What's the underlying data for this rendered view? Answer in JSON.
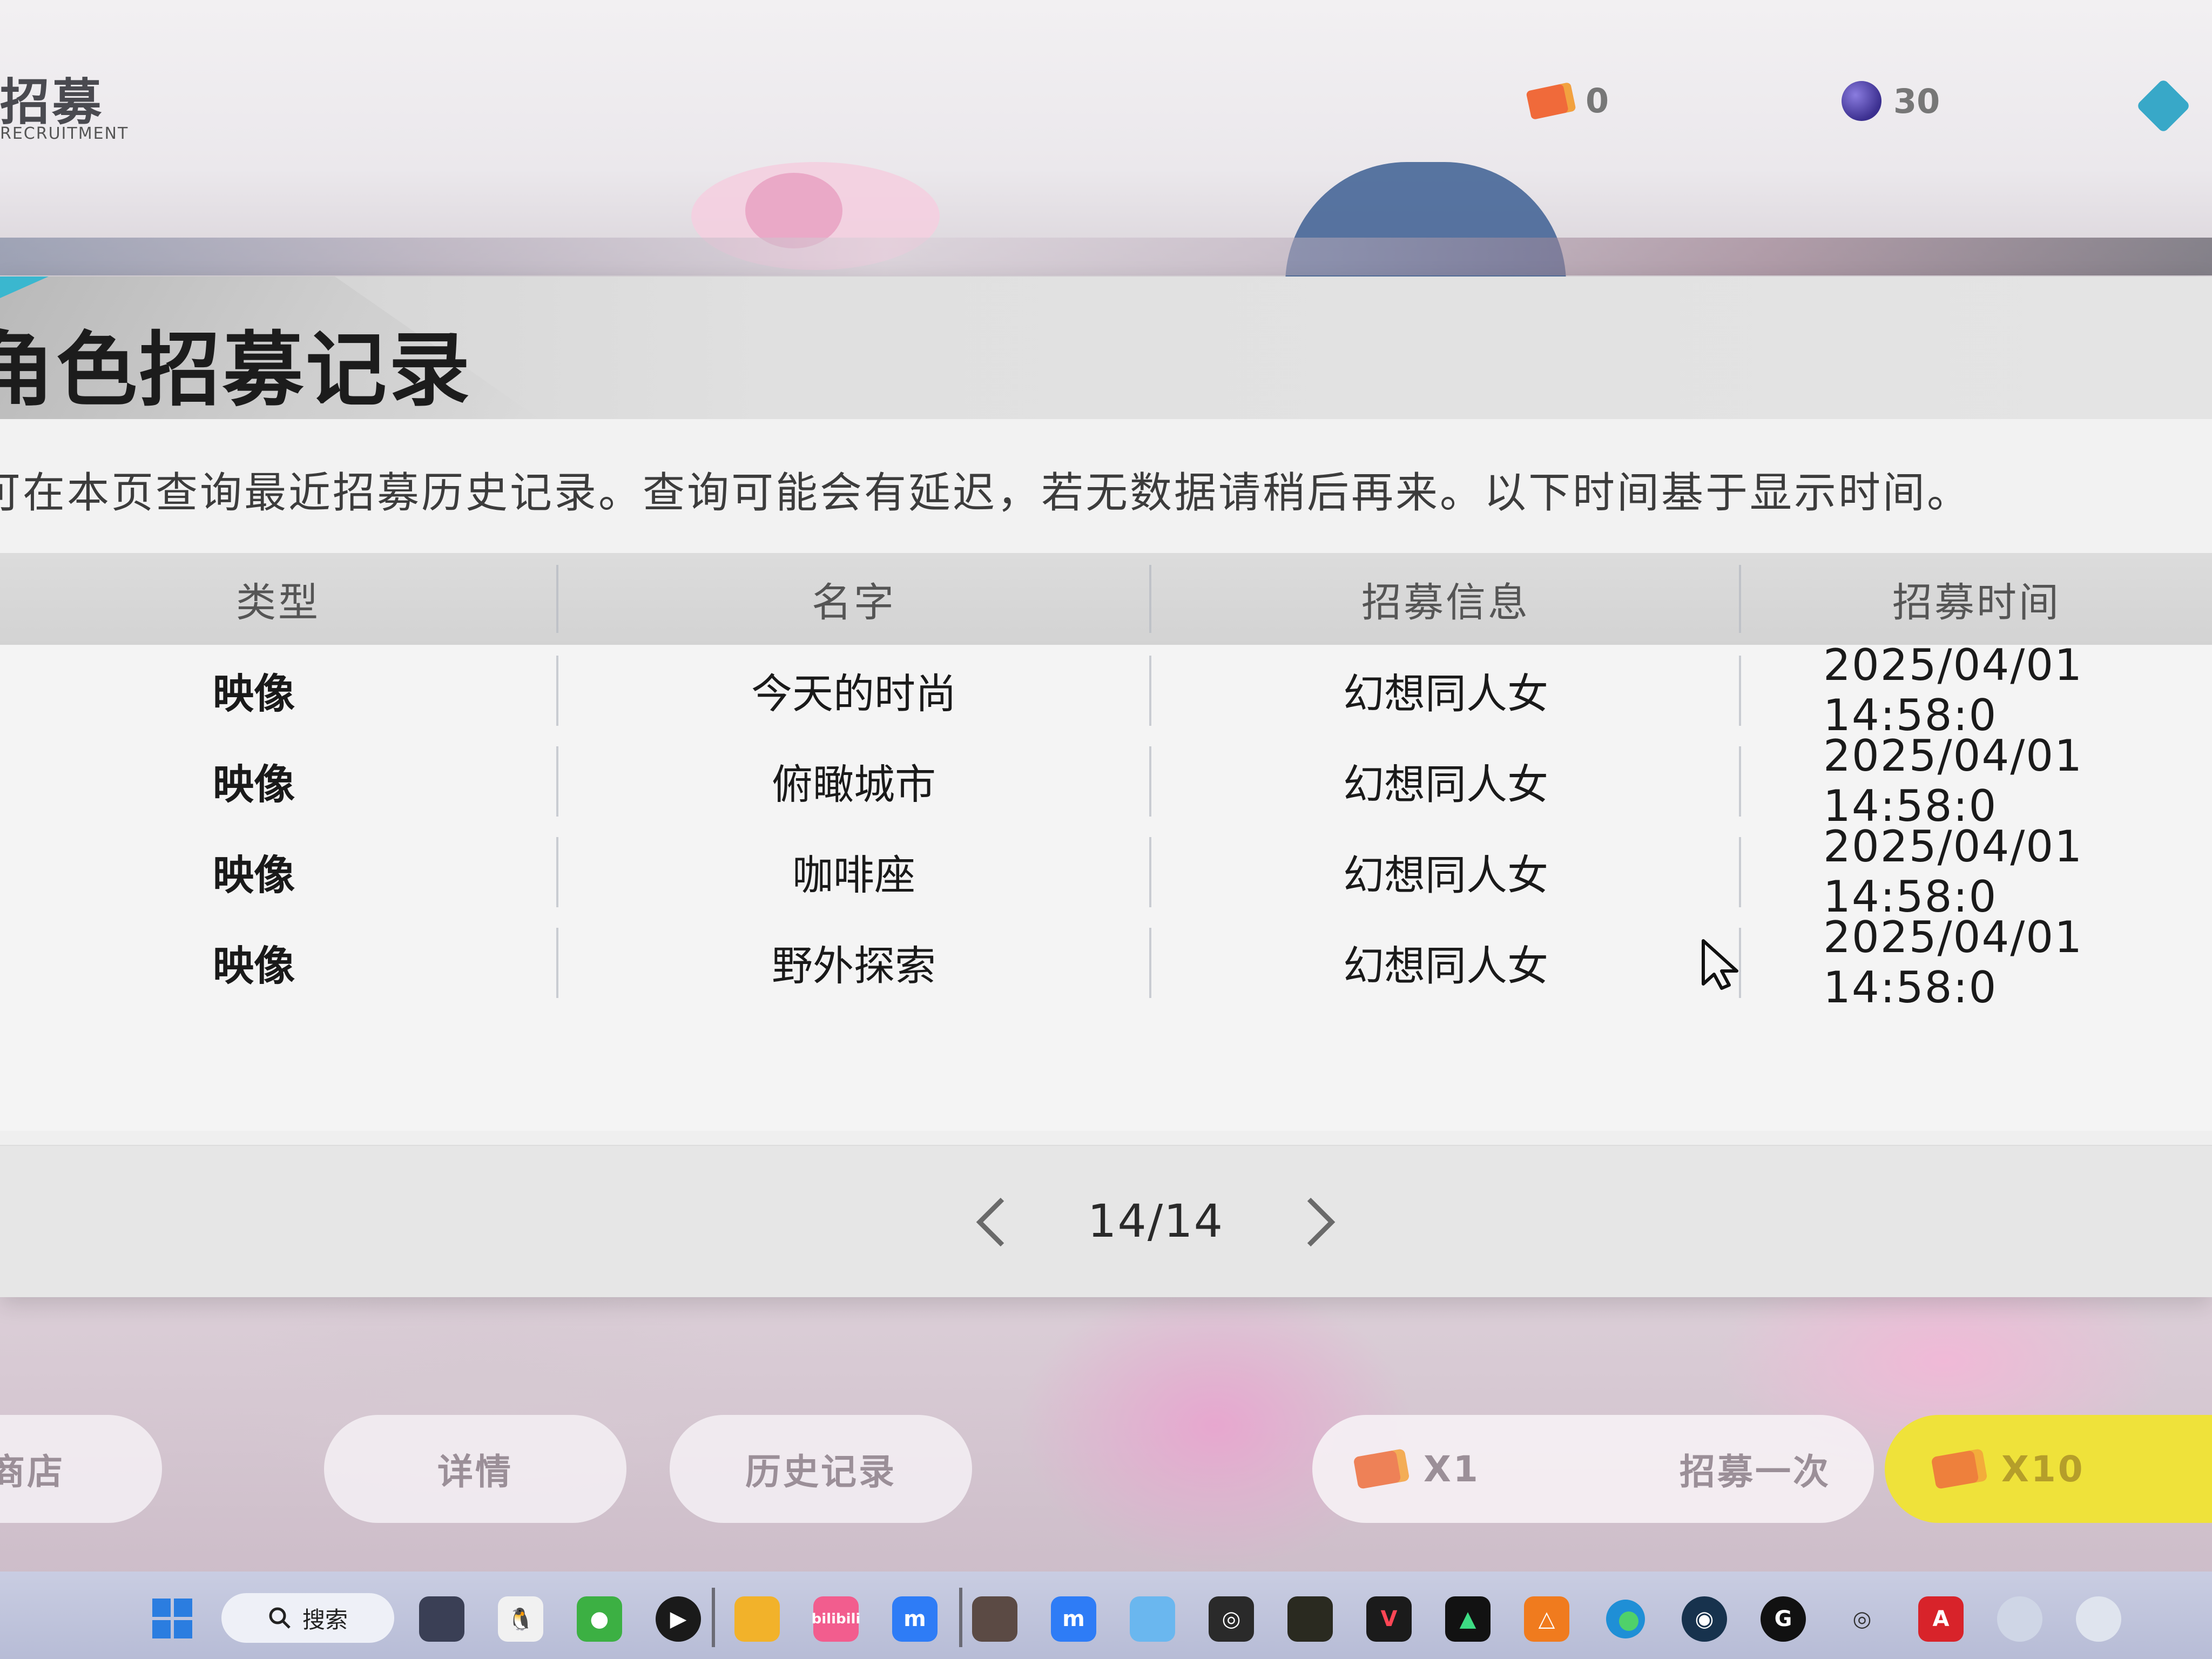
{
  "hud": {
    "title": "招募",
    "subtitle": "RECRUITMENT",
    "tickets": "0",
    "orbs": "30"
  },
  "panel": {
    "title": "角色招募记录",
    "description": "可在本页查询最近招募历史记录。查询可能会有延迟，若无数据请稍后再来。以下时间基于显示时间。"
  },
  "table": {
    "headers": [
      "类型",
      "名字",
      "招募信息",
      "招募时间"
    ],
    "rows": [
      {
        "type": "映像",
        "name": "今天的时尚",
        "info": "幻想同人女",
        "time": "2025/04/01 14:58:0"
      },
      {
        "type": "映像",
        "name": "俯瞰城市",
        "info": "幻想同人女",
        "time": "2025/04/01 14:58:0"
      },
      {
        "type": "映像",
        "name": "咖啡座",
        "info": "幻想同人女",
        "time": "2025/04/01 14:58:0"
      },
      {
        "type": "映像",
        "name": "野外探索",
        "info": "幻想同人女",
        "time": "2025/04/01 14:58:0"
      }
    ]
  },
  "pagination": {
    "label": "14/14",
    "prev_icon": "chevron-left-icon",
    "next_icon": "chevron-right-icon"
  },
  "bottom_buttons": {
    "shop": "商店",
    "detail": "详情",
    "history": "历史记录",
    "pull_once_count": "X1",
    "pull_once": "招募一次",
    "pull_ten_count": "X10"
  },
  "taskbar": {
    "search": "搜索",
    "apps": [
      "task-view-icon",
      "qq-icon",
      "wechat-icon",
      "media-player-icon",
      "file-explorer-icon",
      "bilibili-icon",
      "app-m-icon",
      "game-avatar-icon",
      "app-m2-icon",
      "qq-game-icon",
      "app-launcher-icon",
      "game-cod-icon",
      "valorant-icon",
      "nvidia-icon",
      "app-warning-icon",
      "edge-icon",
      "steam-icon",
      "g-hub-icon",
      "app-circle-icon",
      "autocad-icon",
      "anime-avatar-icon",
      "anime-avatar2-icon"
    ],
    "bilibili_label": "bilibili",
    "autocad_label": "A"
  },
  "colors": {
    "accent": "#3ab7cf",
    "pull_ten": "#efe23a",
    "ticket": "#f06a3a",
    "taskbar": "#c9cde2"
  }
}
